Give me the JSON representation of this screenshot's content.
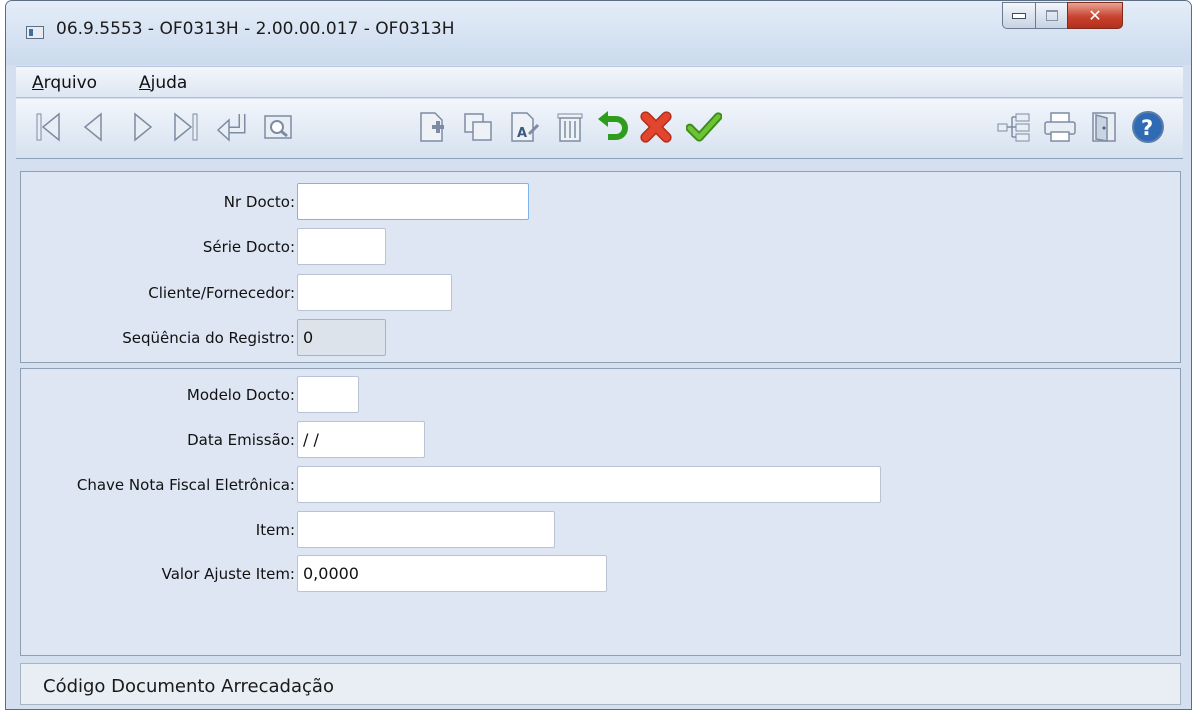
{
  "window": {
    "title": "06.9.5553 - OF0313H - 2.00.00.017 - OF0313H"
  },
  "menu": {
    "arquivo_first": "A",
    "arquivo_rest": "rquivo",
    "ajuda_first": "A",
    "ajuda_rest": "juda"
  },
  "toolbar": {
    "left_icons": [
      "first-record-icon",
      "prev-record-icon",
      "next-record-icon",
      "last-record-icon",
      "goto-return-icon",
      "search-zoom-icon"
    ],
    "middle_icons": [
      "new-record-icon",
      "copy-record-icon",
      "edit-record-icon",
      "delete-record-icon",
      "undo-icon",
      "cancel-icon",
      "confirm-icon"
    ],
    "right_icons": [
      "tree-navigation-icon",
      "print-icon",
      "exit-door-icon",
      "help-icon"
    ],
    "accent_colors": {
      "undo": "#2e9c1c",
      "cancel": "#e2452d",
      "confirm": "#4fae1e",
      "help": "#2f6bb5"
    }
  },
  "form": {
    "nr_docto": {
      "label": "Nr Docto:",
      "value": ""
    },
    "serie_docto": {
      "label": "Série Docto:",
      "value": ""
    },
    "cliente_fornecedor": {
      "label": "Cliente/Fornecedor:",
      "value": ""
    },
    "sequencia_registro": {
      "label": "Seqüência do Registro:",
      "value": "0"
    },
    "modelo_docto": {
      "label": "Modelo Docto:",
      "value": ""
    },
    "data_emissao": {
      "label": "Data Emissão:",
      "value": " / /"
    },
    "chave_nfe": {
      "label": "Chave Nota Fiscal Eletrônica:",
      "value": ""
    },
    "item": {
      "label": "Item:",
      "value": ""
    },
    "valor_ajuste_item": {
      "label": "Valor Ajuste Item:",
      "value": "0,0000"
    }
  },
  "status": {
    "text": "Código Documento Arrecadação"
  }
}
